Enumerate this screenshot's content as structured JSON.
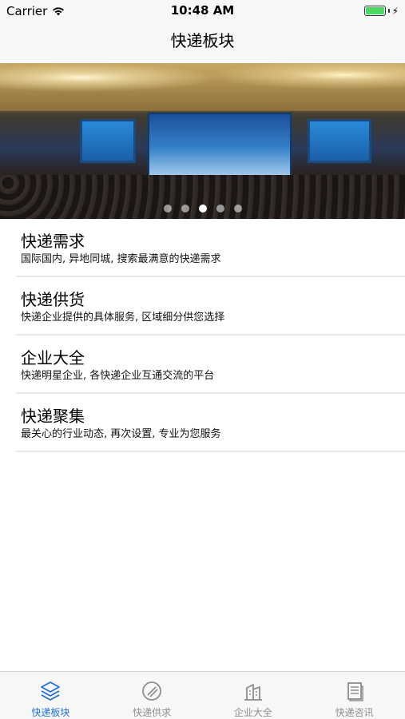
{
  "status_bar": {
    "carrier": "Carrier",
    "time": "10:48 AM",
    "battery_level": 1.0
  },
  "nav": {
    "title": "快递板块"
  },
  "banner": {
    "page_count": 5,
    "active_page": 3
  },
  "list": {
    "items": [
      {
        "title": "快递需求",
        "subtitle": "国际国内, 异地同城, 搜索最满意的快递需求"
      },
      {
        "title": "快递供货",
        "subtitle": "快递企业提供的具体服务, 区域细分供您选择"
      },
      {
        "title": "企业大全",
        "subtitle": "快递明星企业, 各快递企业互通交流的平台"
      },
      {
        "title": "快递聚集",
        "subtitle": "最关心的行业动态, 再次设置, 专业为您服务"
      }
    ]
  },
  "tabs": [
    {
      "label": "快递板块",
      "icon": "layers-icon",
      "active": true
    },
    {
      "label": "快递供求",
      "icon": "slash-circle-icon",
      "active": false
    },
    {
      "label": "企业大全",
      "icon": "building-icon",
      "active": false
    },
    {
      "label": "快递咨讯",
      "icon": "news-icon",
      "active": false
    }
  ],
  "colors": {
    "accent": "#1e6fd8",
    "tab_inactive": "#8e8e8e",
    "battery": "#4cd964"
  }
}
